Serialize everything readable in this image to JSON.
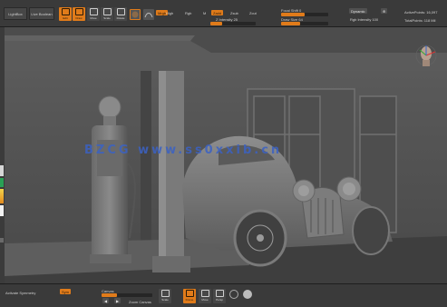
{
  "top": {
    "lightbox_label": "LightBox",
    "live_boolean_label": "Live Boolean",
    "tools": [
      {
        "label": "Edit",
        "icon": "edit-icon",
        "active": true
      },
      {
        "label": "Draw",
        "icon": "draw-icon",
        "active": true
      },
      {
        "label": "Move",
        "icon": "move-icon",
        "active": false
      },
      {
        "label": "Scale",
        "icon": "scale-icon",
        "active": false
      },
      {
        "label": "Rotate",
        "icon": "rotate-icon",
        "active": false
      }
    ],
    "mrgb_label": "Mrgb",
    "rgb_label": "Rgb",
    "m_label": "M",
    "zadd_label": "Zadd",
    "zsub_label": "Zsub",
    "zcut_label": "Zcut",
    "focal_shift_label": "Focal Shift 0",
    "intensity_label": "Z Intensity 25",
    "draw_size_label": "Draw Size 64",
    "dynamic_label": "Dynamic",
    "active_points_label": "ActivePoints: 16,097",
    "total_points_label": "TotalPoints: 118 Mil",
    "rgb_intensity_label": "Rgb Intensity 100",
    "brush_indicator": "High"
  },
  "viewport": {
    "watermark": "BZCG   www.ss0xxib.cn"
  },
  "bottom": {
    "items": [
      {
        "label": "Activate Symmetry"
      },
      {
        "label": "Sym"
      },
      {
        "label": "Canvas"
      },
      {
        "label": "Zoom Canvas"
      },
      {
        "label": "Scale"
      },
      {
        "label": "Frame"
      },
      {
        "label": "Move"
      },
      {
        "label": "Persp"
      }
    ]
  },
  "colors": {
    "accent": "#e07b1a",
    "watermark": "#3b62c4",
    "panel": "#3a3a3a",
    "viewport": "#4a4a4a"
  }
}
